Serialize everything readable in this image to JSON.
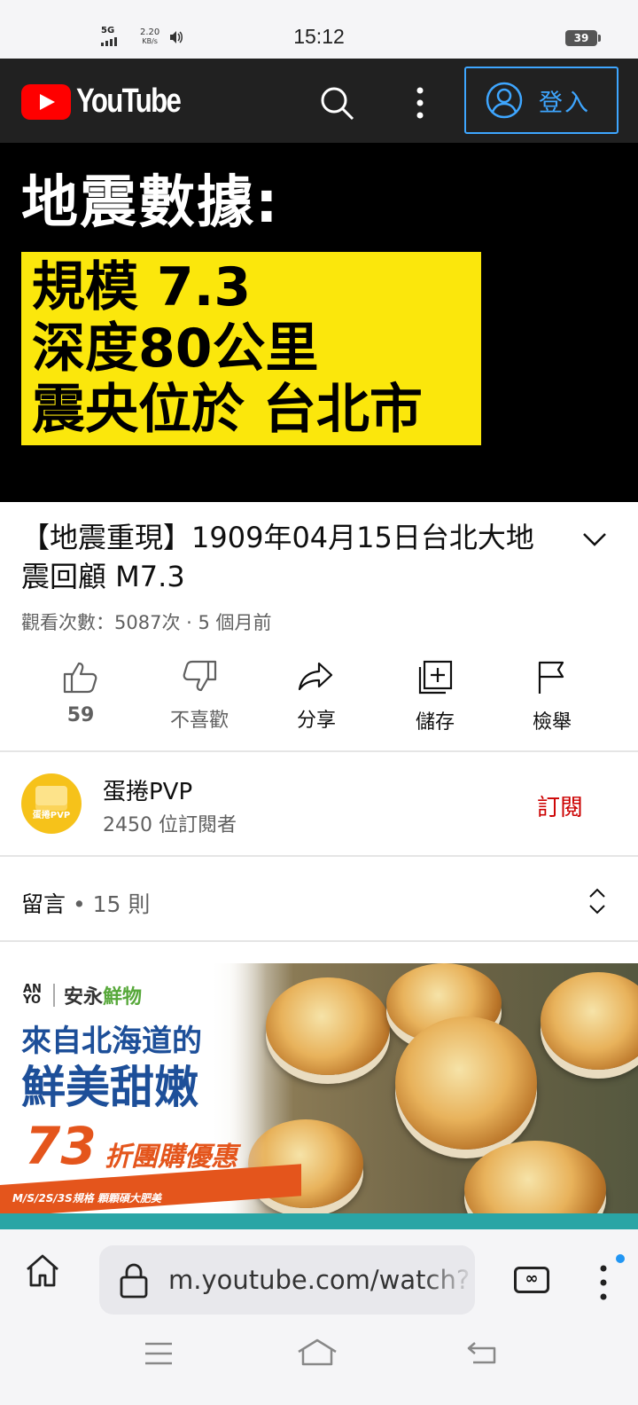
{
  "status_bar": {
    "network": "5G",
    "speed_value": "2.20",
    "speed_unit": "KB/s",
    "time": "15:12",
    "battery": "39"
  },
  "header": {
    "logo_text": "YouTube",
    "signin_label": "登入"
  },
  "video": {
    "overlay_title": "地震數據:",
    "overlay_lines": [
      "規模 7.3",
      "深度80公里",
      "震央位於 台北市"
    ]
  },
  "info": {
    "title": "【地震重現】1909年04月15日台北大地震回顧 M7.3",
    "meta": "觀看次數：5087次 · 5 個月前"
  },
  "actions": {
    "like_count": "59",
    "dislike_label": "不喜歡",
    "share_label": "分享",
    "save_label": "儲存",
    "report_label": "檢舉"
  },
  "channel": {
    "avatar_text": "蛋捲PVP",
    "name": "蛋捲PVP",
    "subscribers": "2450 位訂閱者",
    "subscribe_label": "訂閱"
  },
  "comments": {
    "label": "留言",
    "count": " • 15 則"
  },
  "ad": {
    "brand_logo": "AN YO",
    "brand_name": "安永",
    "brand_name_accent": "鮮物",
    "line1": "來自北海道的",
    "line2": "鮮美甜嫩",
    "discount": "73",
    "offer": "折團購優惠",
    "strip": "M/S/2S/3S規格 顆顆碩大肥美"
  },
  "browser": {
    "url": "m.youtube.com/watch?",
    "tabs_icon": "infinity-tabs-icon"
  },
  "colors": {
    "youtube_red": "#ff0000",
    "header_bg": "#212121",
    "signin_blue": "#3ea6ff",
    "subscribe_red": "#cc0000",
    "overlay_yellow": "#fbe70c"
  }
}
